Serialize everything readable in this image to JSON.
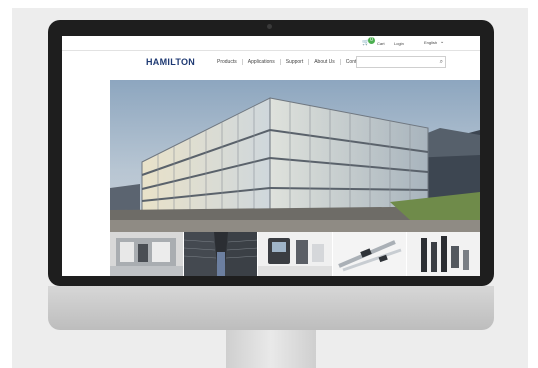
{
  "topbar": {
    "cart_label": "Cart",
    "cart_count": "0",
    "login_label": "Login",
    "language_label": "English"
  },
  "header": {
    "logo_text": "HAMILTON",
    "nav": [
      "Products",
      "Applications",
      "Support",
      "About Us",
      "Contact Us"
    ],
    "search_placeholder": ""
  },
  "icons": {
    "cart": "cart-icon",
    "search": "search-icon",
    "chevron": "chevron-down-icon"
  },
  "colors": {
    "brand": "#1f3a73",
    "cart_badge": "#4caf50"
  }
}
